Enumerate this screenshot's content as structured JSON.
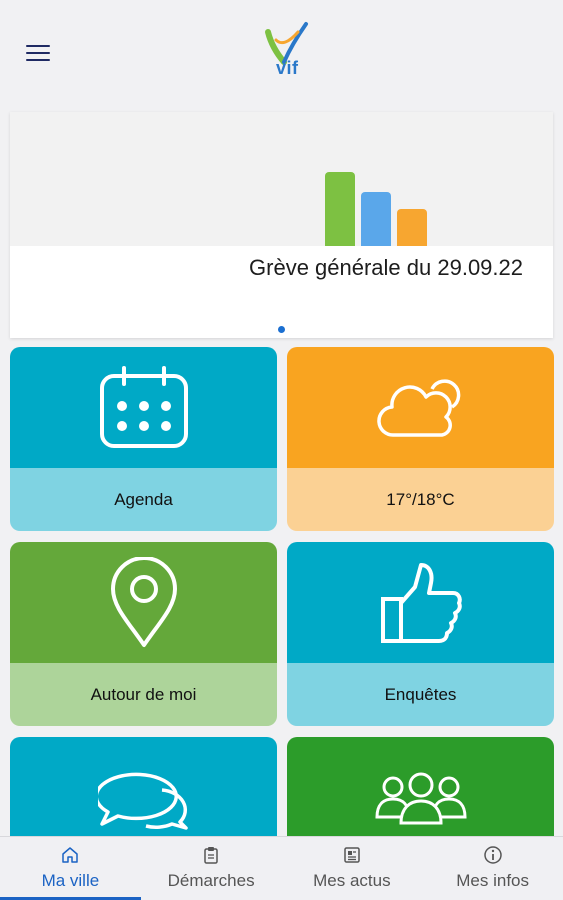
{
  "header": {
    "menu_icon": "menu-icon",
    "logo_text": "vif"
  },
  "slider": {
    "title": "Grève générale du 29.09.22",
    "bar_colors": [
      "#7dc142",
      "#5aa7ea",
      "#f7a630"
    ]
  },
  "tiles": [
    {
      "label": "Agenda",
      "icon": "calendar-icon",
      "top_color": "#00a9c6",
      "bottom_color": "#7fd3e2"
    },
    {
      "label": "17°/18°C",
      "icon": "cloud-icon",
      "top_color": "#f9a420",
      "bottom_color": "#fbd194"
    },
    {
      "label": "Autour de moi",
      "icon": "location-pin-icon",
      "top_color": "#64a83a",
      "bottom_color": "#add49a"
    },
    {
      "label": "Enquêtes",
      "icon": "thumbs-up-icon",
      "top_color": "#00a9c6",
      "bottom_color": "#7fd3e2"
    },
    {
      "label": "",
      "icon": "chat-bubbles-icon",
      "top_color": "#00a9c6",
      "bottom_color": "#7fd3e2"
    },
    {
      "label": "",
      "icon": "group-icon",
      "top_color": "#2c9c2a",
      "bottom_color": "#94ce8e"
    }
  ],
  "tabbar": {
    "items": [
      {
        "label": "Ma ville",
        "icon": "home-icon",
        "active": true
      },
      {
        "label": "Démarches",
        "icon": "clipboard-icon",
        "active": false
      },
      {
        "label": "Mes actus",
        "icon": "newspaper-icon",
        "active": false
      },
      {
        "label": "Mes infos",
        "icon": "info-icon",
        "active": false
      }
    ]
  },
  "colors": {
    "accent": "#1b63c4"
  }
}
